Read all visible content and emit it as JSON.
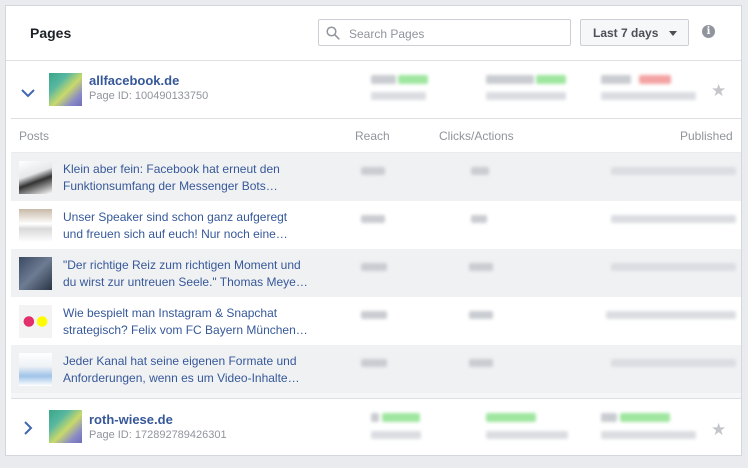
{
  "header": {
    "title": "Pages",
    "search_placeholder": "Search Pages",
    "search_value": "",
    "date_range": "Last 7 days"
  },
  "pages": [
    {
      "name": "allfacebook.de",
      "page_id": "Page ID: 100490133750",
      "expanded": true
    },
    {
      "name": "roth-wiese.de",
      "page_id": "Page ID: 172892789426301",
      "expanded": false
    }
  ],
  "posts_table": {
    "columns": [
      "Posts",
      "Reach",
      "Clicks/Actions",
      "Published"
    ],
    "rows": [
      {
        "line1": "Klein aber fein: Facebook hat erneut den",
        "line2": "Funktionsumfang der Messenger Bots…"
      },
      {
        "line1": "Unser Speaker sind schon ganz aufgeregt",
        "line2": "und freuen sich auf euch! Nur noch eine…"
      },
      {
        "line1": "\"Der richtige Reiz zum richtigen Moment und",
        "line2": "du wirst zur untreuen Seele.\" Thomas Meye…"
      },
      {
        "line1": "Wie bespielt man Instagram & Snapchat",
        "line2": "strategisch? Felix vom FC Bayern München…"
      },
      {
        "line1": "Jeder Kanal hat seine eigenen Formate und",
        "line2": "Anforderungen, wenn es um Video-Inhalte…"
      }
    ]
  },
  "icons": {
    "search": "search-icon",
    "caret": "caret-down-icon",
    "info": "info-icon",
    "expanded": "chevron-down-icon",
    "collapsed": "chevron-right-icon",
    "favorite": "star-icon"
  },
  "colors": {
    "link": "#365899",
    "muted": "#90949c",
    "metric_up": "#9fe6a0",
    "metric_down": "#f4a3a3"
  }
}
